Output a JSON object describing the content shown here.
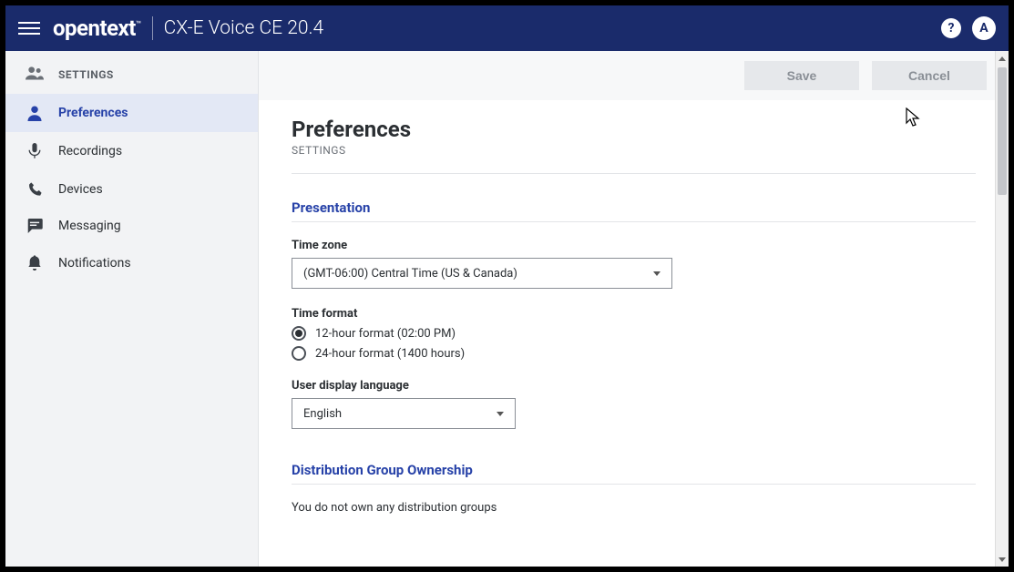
{
  "header": {
    "brand": "opentext",
    "tm": "™",
    "product": "CX-E Voice CE 20.4",
    "avatar_initial": "A"
  },
  "sidebar": {
    "group_label": "SETTINGS",
    "items": [
      {
        "label": "Preferences"
      },
      {
        "label": "Recordings"
      },
      {
        "label": "Devices"
      },
      {
        "label": "Messaging"
      },
      {
        "label": "Notifications"
      }
    ]
  },
  "toolbar": {
    "save_label": "Save",
    "cancel_label": "Cancel"
  },
  "page": {
    "title": "Preferences",
    "subtitle": "SETTINGS"
  },
  "presentation": {
    "section_title": "Presentation",
    "timezone_label": "Time zone",
    "timezone_value": "(GMT-06:00) Central Time (US & Canada)",
    "timeformat_label": "Time format",
    "timeformat_options": [
      "12-hour format (02:00 PM)",
      "24-hour format (1400 hours)"
    ],
    "timeformat_selected_index": 0,
    "language_label": "User display language",
    "language_value": "English"
  },
  "distribution": {
    "section_title": "Distribution Group Ownership",
    "empty_text": "You do not own any distribution groups"
  }
}
